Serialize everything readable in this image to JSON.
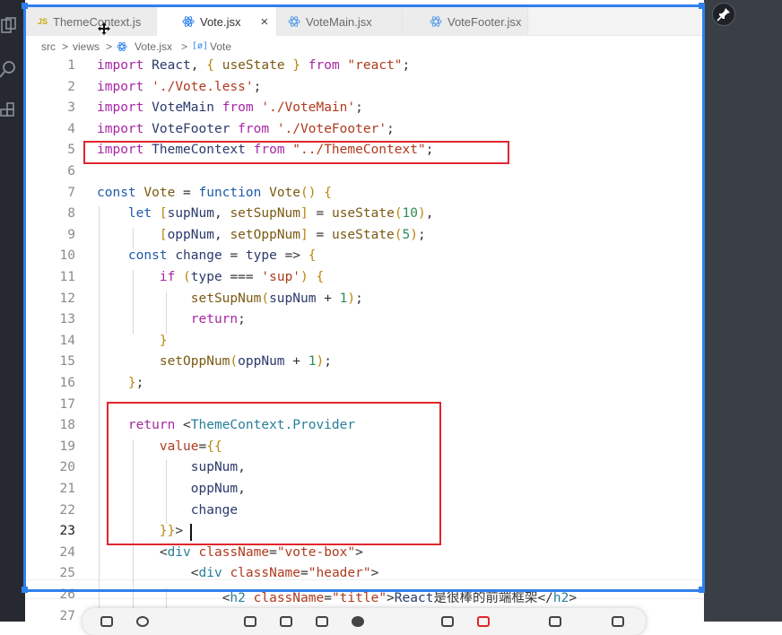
{
  "tabs": [
    {
      "icon": "JS",
      "label": "ThemeContext.js",
      "active": false
    },
    {
      "icon": "react-icon",
      "label": "Vote.jsx",
      "active": true,
      "close": "×"
    },
    {
      "icon": "react-icon",
      "label": "VoteMain.jsx",
      "active": false
    },
    {
      "icon": "react-icon",
      "label": "VoteFooter.jsx",
      "active": false
    }
  ],
  "breadcrumb": [
    "src",
    "views",
    "Vote.jsx",
    "Vote"
  ],
  "breadcrumb_sep": ">",
  "line_numbers": [
    "1",
    "2",
    "3",
    "4",
    "5",
    "6",
    "7",
    "8",
    "9",
    "10",
    "11",
    "12",
    "13",
    "14",
    "15",
    "16",
    "17",
    "18",
    "19",
    "20",
    "21",
    "22",
    "23",
    "24",
    "25",
    "26",
    "27"
  ],
  "current_line": "23",
  "code_lines": [
    "import React, { useState } from \"react\";",
    "import './Vote.less';",
    "import VoteMain from './VoteMain';",
    "import VoteFooter from './VoteFooter';",
    "import ThemeContext from \"../ThemeContext\";",
    "",
    "const Vote = function Vote() {",
    "    let [supNum, setSupNum] = useState(10),",
    "        [oppNum, setOppNum] = useState(5);",
    "    const change = type => {",
    "        if (type === 'sup') {",
    "            setSupNum(supNum + 1);",
    "            return;",
    "        }",
    "        setOppNum(oppNum + 1);",
    "    };",
    "",
    "    return <ThemeContext.Provider",
    "        value={{",
    "            supNum,",
    "            oppNum,",
    "            change",
    "        }}>",
    "        <div className=\"vote-box\">",
    "            <div className=\"header\">",
    "                <h2 className=\"title\">React是很棒的前端框架</h2>",
    ""
  ],
  "colors": {
    "highlight_box": "#e0262c",
    "selection_frame": "#2f80ed",
    "keyword": "#a626a4",
    "string": "#b03a1e"
  },
  "icons": [
    "explorer-icon",
    "search-icon",
    "extensions-icon",
    "pin-icon",
    "move-cursor-icon",
    "react-icon"
  ]
}
